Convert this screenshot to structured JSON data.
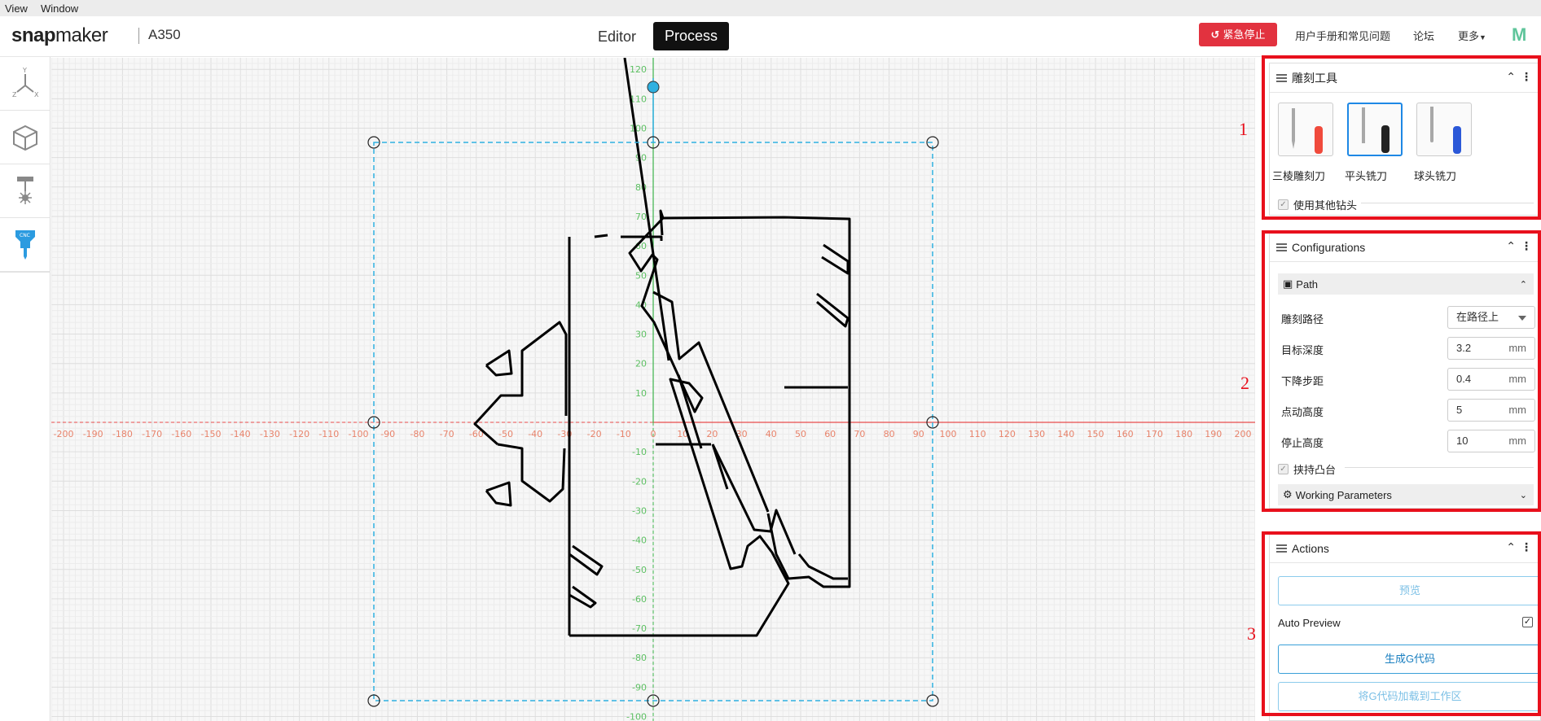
{
  "menu": [
    "View",
    "Window"
  ],
  "header": {
    "brand_a": "snap",
    "brand_b": "maker",
    "model": "A350",
    "tab_editor": "Editor",
    "tab_process": "Process",
    "estop": "紧急停止",
    "link_manual": "用户手册和常见问题",
    "link_forum": "论坛",
    "link_more": "更多",
    "profile_initial": "M"
  },
  "toolbar": {
    "icons": [
      "axes-icon",
      "cube-icon",
      "laser-icon",
      "cnc-icon"
    ]
  },
  "canvas": {
    "x_ticks": [
      "-200",
      "-190",
      "-180",
      "-170",
      "-160",
      "-150",
      "-140",
      "-130",
      "-120",
      "-110",
      "-100",
      "-90",
      "-80",
      "-70",
      "-60",
      "-50",
      "-40",
      "-30",
      "-20",
      "-10",
      "0",
      "10",
      "20",
      "30",
      "40",
      "50",
      "60",
      "70",
      "80",
      "90",
      "100",
      "110",
      "120",
      "130",
      "140",
      "150",
      "160",
      "170",
      "180",
      "190",
      "200"
    ],
    "y_ticks": [
      "120",
      "110",
      "100",
      "90",
      "80",
      "70",
      "60",
      "50",
      "40",
      "30",
      "20",
      "10",
      "-10",
      "-20",
      "-30",
      "-40",
      "-50",
      "-60",
      "-70",
      "-80",
      "-90",
      "-100"
    ]
  },
  "panels": {
    "tools": {
      "title": "雕刻工具",
      "items": [
        {
          "label": "三棱雕刻刀",
          "color": "#f04a3c",
          "selected": false
        },
        {
          "label": "平头铣刀",
          "color": "#222222",
          "selected": true
        },
        {
          "label": "球头铣刀",
          "color": "#2b58d8",
          "selected": false
        }
      ],
      "use_other": "使用其他钻头"
    },
    "config": {
      "title": "Configurations",
      "path_section": "Path",
      "rows": [
        {
          "label": "雕刻路径",
          "value": "在路径上",
          "unit": ""
        },
        {
          "label": "目标深度",
          "value": "3.2",
          "unit": "mm"
        },
        {
          "label": "下降步距",
          "value": "0.4",
          "unit": "mm"
        },
        {
          "label": "点动高度",
          "value": "5",
          "unit": "mm"
        },
        {
          "label": "停止高度",
          "value": "10",
          "unit": "mm"
        }
      ],
      "tabs_label": "挟持凸台",
      "working_section": "Working Parameters"
    },
    "actions": {
      "title": "Actions",
      "preview": "预览",
      "auto_preview": "Auto Preview",
      "generate": "生成G代码",
      "load": "将G代码加载到工作区"
    }
  },
  "annotations": [
    "1",
    "2",
    "3"
  ],
  "colors": {
    "estop": "#e2323f",
    "x_axis": "#e84b4b",
    "y_axis": "#3cb44b",
    "selection": "#2fb0e0",
    "annotation": "#e8101c"
  }
}
